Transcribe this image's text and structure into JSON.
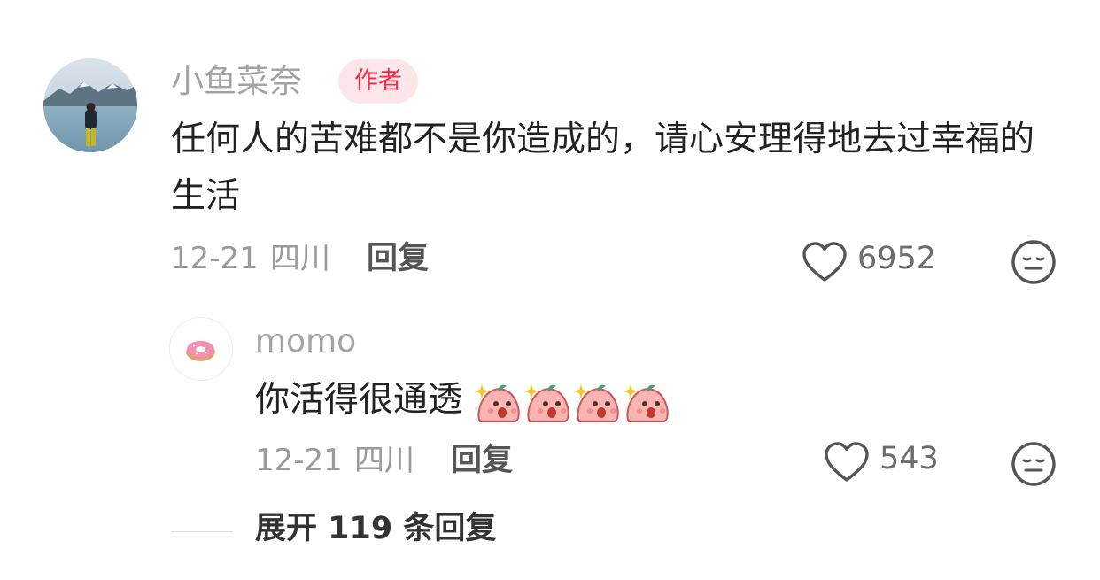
{
  "comment": {
    "author": "小鱼菜奈",
    "author_badge": "作者",
    "text": "任何人的苦难都不是你造成的，请心安理得地去过幸福的生活",
    "date": "12-21",
    "location": "四川",
    "reply_label": "回复",
    "likes": "6952",
    "icons": {
      "avatar": "avatar-landscape",
      "like": "heart-icon",
      "react": "neutral-face-icon"
    }
  },
  "reply": {
    "author": "momo",
    "text": "你活得很通透",
    "emoji_count": 4,
    "date": "12-21",
    "location": "四川",
    "reply_label": "回复",
    "likes": "543",
    "icons": {
      "avatar": "donut-avatar",
      "like": "heart-icon",
      "react": "neutral-face-icon",
      "emoji": "peach-blob-emoji"
    }
  },
  "expand": {
    "label": "展开 119 条回复"
  },
  "colors": {
    "badge_bg": "#fde6ea",
    "badge_text": "#f02c4b",
    "muted": "#9a9a9a"
  }
}
